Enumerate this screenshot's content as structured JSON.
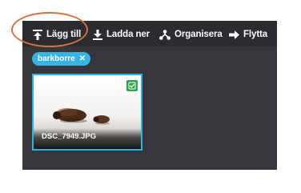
{
  "toolbar": {
    "add_label": "Lägg till",
    "add_icon": "upload-icon",
    "download_label": "Ladda ner",
    "download_icon": "download-icon",
    "organize_label": "Organisera",
    "organize_icon": "organize-icon",
    "move_label": "Flytta",
    "move_icon": "arrow-right-icon"
  },
  "filter": {
    "tag_label": "barkborre",
    "remove_symbol": "✕"
  },
  "gallery": {
    "items": [
      {
        "filename": "DSC_7949.JPG",
        "selected": true,
        "checked": true
      }
    ]
  },
  "colors": {
    "panel_background": "#36363d",
    "toolbar_background": "#2b2b31",
    "accent": "#36b5e5",
    "check_green": "#2da44a",
    "annotation": "#d5713a"
  }
}
